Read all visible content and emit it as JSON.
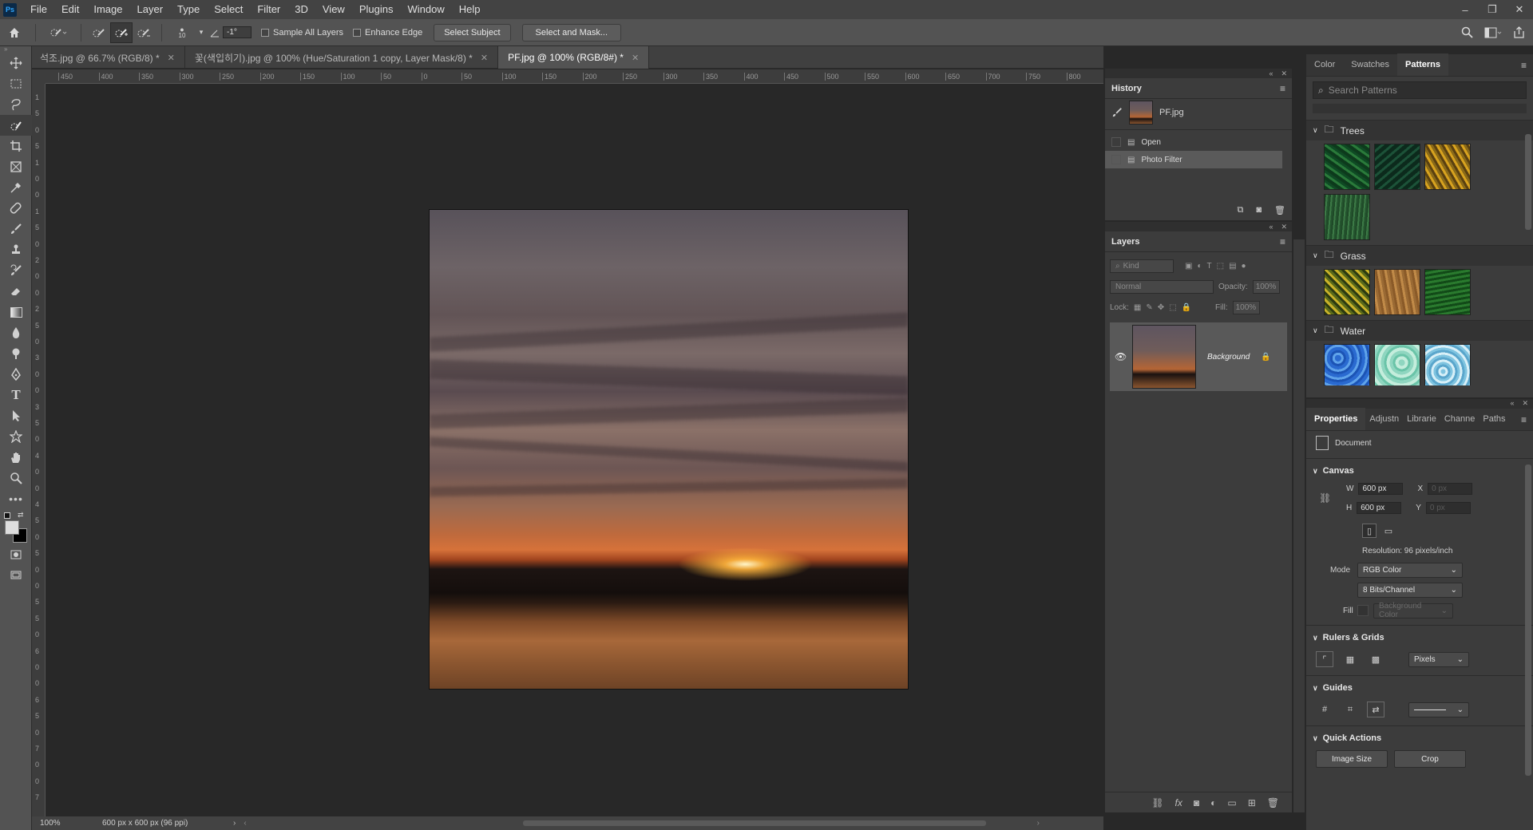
{
  "app": {
    "logo": "Ps"
  },
  "menu": [
    "File",
    "Edit",
    "Image",
    "Layer",
    "Type",
    "Select",
    "Filter",
    "3D",
    "View",
    "Plugins",
    "Window",
    "Help"
  ],
  "window_controls": {
    "minimize": "–",
    "restore": "❐",
    "close": "✕"
  },
  "options": {
    "brush_size": "10",
    "angle": "-1°",
    "sample_all_layers": "Sample All Layers",
    "enhance_edge": "Enhance Edge",
    "select_subject": "Select Subject",
    "select_and_mask": "Select and Mask..."
  },
  "tabs": [
    {
      "label": "석조.jpg @ 66.7% (RGB/8) *",
      "active": false
    },
    {
      "label": "꽃(색입히기).jpg @ 100% (Hue/Saturation 1 copy, Layer Mask/8) *",
      "active": false
    },
    {
      "label": "PF.jpg @ 100% (RGB/8#) *",
      "active": true
    }
  ],
  "ruler_h": [
    "450",
    "400",
    "350",
    "300",
    "250",
    "200",
    "150",
    "100",
    "50",
    "0",
    "50",
    "100",
    "150",
    "200",
    "250",
    "300",
    "350",
    "400",
    "450",
    "500",
    "550",
    "600",
    "650",
    "700",
    "750",
    "800"
  ],
  "ruler_v": [
    "1",
    "5",
    "0",
    "5",
    "1",
    "0",
    "0",
    "1",
    "5",
    "0",
    "2",
    "0",
    "0",
    "2",
    "5",
    "0",
    "3",
    "0",
    "0",
    "3",
    "5",
    "0",
    "4",
    "0",
    "0",
    "4",
    "5",
    "0",
    "5",
    "0",
    "0",
    "5",
    "5",
    "0",
    "6",
    "0",
    "0",
    "6",
    "5",
    "0",
    "7",
    "0",
    "0",
    "7"
  ],
  "status": {
    "zoom": "100%",
    "doc_info": "600 px x 600 px (96 ppi)"
  },
  "history": {
    "title": "History",
    "snapshot": "PF.jpg",
    "items": [
      {
        "label": "Open",
        "selected": false
      },
      {
        "label": "Photo Filter",
        "selected": true
      }
    ]
  },
  "layers": {
    "title": "Layers",
    "kind": "Kind",
    "blend": "Normal",
    "opacity_label": "Opacity:",
    "opacity": "100%",
    "lock_label": "Lock:",
    "fill_label": "Fill:",
    "fill": "100%",
    "layer_name": "Background"
  },
  "patterns_panel": {
    "tabs": [
      {
        "label": "Color",
        "active": false
      },
      {
        "label": "Swatches",
        "active": false
      },
      {
        "label": "Patterns",
        "active": true
      }
    ],
    "search_placeholder": "Search Patterns",
    "groups": [
      {
        "name": "Trees"
      },
      {
        "name": "Grass"
      },
      {
        "name": "Water"
      }
    ]
  },
  "properties": {
    "tabs": [
      {
        "label": "Properties",
        "active": true
      },
      {
        "label": "Adjustn",
        "active": false
      },
      {
        "label": "Librarie",
        "active": false
      },
      {
        "label": "Channe",
        "active": false
      },
      {
        "label": "Paths",
        "active": false
      }
    ],
    "doc_label": "Document",
    "canvas_title": "Canvas",
    "w_label": "W",
    "w": "600 px",
    "h_label": "H",
    "h": "600 px",
    "x_label": "X",
    "x": "0 px",
    "y_label": "Y",
    "y": "0 px",
    "resolution": "Resolution: 96 pixels/inch",
    "mode_label": "Mode",
    "mode": "RGB Color",
    "bits": "8 Bits/Channel",
    "fill_label": "Fill",
    "fill": "Background Color",
    "rulers_title": "Rulers & Grids",
    "units": "Pixels",
    "guides_title": "Guides",
    "quick_actions_title": "Quick Actions",
    "image_size": "Image Size",
    "crop": "Crop"
  }
}
